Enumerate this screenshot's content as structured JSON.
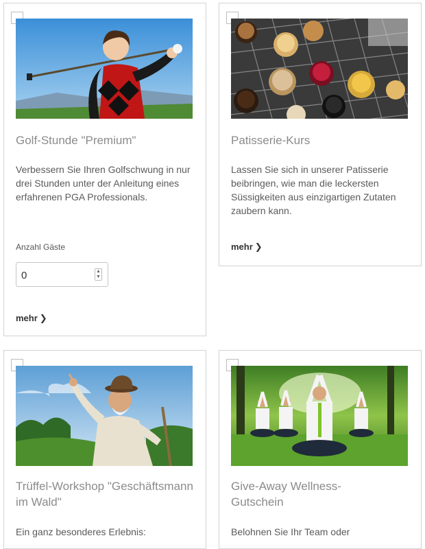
{
  "cards": [
    {
      "title": "Golf-Stunde \"Premium\"",
      "description": "Verbessern Sie Ihren Golfschwung in nur drei Stunden unter der Anleitung eines erfahrenen PGA Professionals.",
      "guests_label": "Anzahl Gäste",
      "guests_value": "0",
      "more_label": "mehr",
      "image": "golfer-photo"
    },
    {
      "title": "Patisserie-Kurs",
      "description": "Lassen Sie sich in unserer Patisserie beibringen, wie man die leckersten Süssigkeiten aus einzigartigen Zutaten zaubern kann.",
      "more_label": "mehr",
      "image": "pralines-photo"
    },
    {
      "title": "Trüffel-Workshop \"Geschäftsmann im Wald\"",
      "description": "Ein ganz besonderes Erlebnis:",
      "image": "old-man-forest-photo"
    },
    {
      "title": "Give-Away Wellness-Gutschein",
      "description": "Belohnen Sie Ihr Team oder",
      "image": "yoga-group-photo"
    }
  ],
  "icons": {
    "more": "chevron-right-icon",
    "spinner": "spinner-arrows-icon"
  }
}
